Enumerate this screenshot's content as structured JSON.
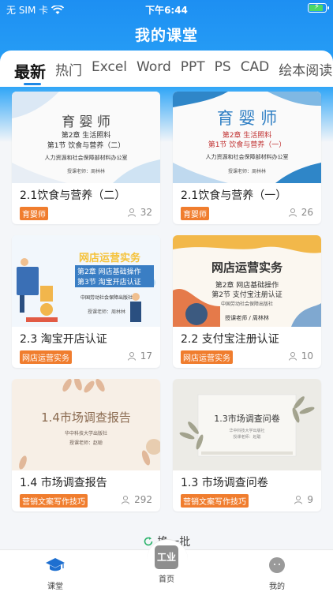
{
  "status_bar": {
    "carrier": "无 SIM 卡",
    "time": "下午6:44"
  },
  "header": {
    "title": "我的课堂"
  },
  "tabs": [
    {
      "label": "最新",
      "active": true
    },
    {
      "label": "热门"
    },
    {
      "label": "Excel"
    },
    {
      "label": "Word"
    },
    {
      "label": "PPT"
    },
    {
      "label": "PS"
    },
    {
      "label": "CAD"
    },
    {
      "label": "绘本阅读"
    }
  ],
  "courses": [
    {
      "title": "2.1饮食与营养（二）",
      "tag": "育婴师",
      "count": "32",
      "thumb": {
        "heading": "育 婴 师",
        "chapter": "第2章  生活照料",
        "section": "第1节  饮食与营养（二）",
        "publisher": "人力资源和社会保障部材料办公室",
        "teacher": "授课老师：周林林"
      }
    },
    {
      "title": "2.1饮食与营养（一）",
      "tag": "育婴师",
      "count": "26",
      "thumb": {
        "heading": "育 婴 师",
        "chapter": "第2章  生活照料",
        "section": "第1节  饮食与营养（一）",
        "publisher": "人力资源和社会保障部材料办公室",
        "teacher": "授课老师：周林林"
      }
    },
    {
      "title": "2.3 淘宝开店认证",
      "tag": "网店运营实务",
      "count": "17",
      "thumb": {
        "heading": "网店运营实务",
        "chapter": "第2章  网店基础操作",
        "section": "第3节  淘宝开店认证",
        "publisher": "中国劳动社会保障出版社",
        "teacher": "授课老师：周林林"
      }
    },
    {
      "title": "2.2 支付宝注册认证",
      "tag": "网店运营实务",
      "count": "10",
      "thumb": {
        "heading": "网店运营实务",
        "chapter": "第2章  网店基础操作",
        "section": "第2节  支付宝注册认证",
        "publisher": "中国劳动社会保障出版社",
        "teacher": "授课老师 / 周林林"
      }
    },
    {
      "title": "1.4 市场调查报告",
      "tag": "营销文案写作技巧",
      "count": "292",
      "thumb": {
        "heading": "1.4市场调查报告",
        "chapter": "华中科技大学出版社",
        "section": "授课老师：赵聪",
        "publisher": "",
        "teacher": ""
      }
    },
    {
      "title": "1.3 市场调查问卷",
      "tag": "营销文案写作技巧",
      "count": "9",
      "thumb": {
        "heading": "1.3市场调查问卷",
        "chapter": "华中科技大学出版社",
        "section": "授课老师：赵聪",
        "publisher": "",
        "teacher": ""
      }
    }
  ],
  "refresh_label": "换一批",
  "bottom_nav": [
    {
      "label": "课堂",
      "icon": "graduation-cap-icon",
      "active": true
    },
    {
      "label": "首页",
      "icon": "industry-icon",
      "center_text": "工业"
    },
    {
      "label": "我的",
      "icon": "profile-face-icon"
    }
  ],
  "colors": {
    "primary": "#1e88e5",
    "tag_bg": "#f07d2e"
  }
}
